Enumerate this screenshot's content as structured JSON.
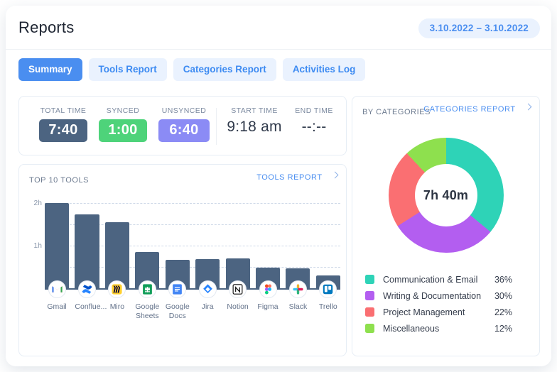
{
  "header": {
    "title": "Reports",
    "date_range": "3.10.2022 – 3.10.2022"
  },
  "tabs": [
    {
      "label": "Summary",
      "active": true
    },
    {
      "label": "Tools Report",
      "active": false
    },
    {
      "label": "Categories Report",
      "active": false
    },
    {
      "label": "Activities Log",
      "active": false
    }
  ],
  "stats": [
    {
      "label": "TOTAL TIME",
      "value": "7:40",
      "style": "pill",
      "color": "#4c6481"
    },
    {
      "label": "SYNCED",
      "value": "1:00",
      "style": "pill",
      "color": "#4ed37a"
    },
    {
      "label": "UNSYNCED",
      "value": "6:40",
      "style": "pill",
      "color": "#8b8bf5"
    },
    {
      "label": "START  TIME",
      "value": "9:18 am",
      "style": "plain",
      "color": "#303a4b"
    },
    {
      "label": "END TIME",
      "value": "--:--",
      "style": "plain",
      "color": "#303a4b"
    }
  ],
  "tools_panel": {
    "title": "TOP 10 TOOLS",
    "link": "TOOLS REPORT"
  },
  "categories_panel": {
    "title": "BY CATEGORIES",
    "link": "CATEGORIES REPORT",
    "center_label": "7h 40m"
  },
  "chart_data": [
    {
      "type": "bar",
      "title": "TOP 10 TOOLS",
      "xlabel": "",
      "ylabel": "",
      "ylim": [
        0,
        2.17
      ],
      "yticks": [
        1,
        2
      ],
      "ytick_labels": [
        "1h",
        "2h"
      ],
      "grid": true,
      "bar_color": "#4c6481",
      "categories": [
        "Gmail",
        "Conflue...",
        "Miro",
        "Google Sheets",
        "Google Docs",
        "Jira",
        "Notion",
        "Figma",
        "Slack",
        "Trello"
      ],
      "values": [
        2.0,
        1.74,
        1.55,
        0.85,
        0.67,
        0.68,
        0.7,
        0.48,
        0.47,
        0.3
      ],
      "icons": [
        "gmail-icon",
        "confluence-icon",
        "miro-icon",
        "google-sheets-icon",
        "google-docs-icon",
        "jira-icon",
        "notion-icon",
        "figma-icon",
        "slack-icon",
        "trello-icon"
      ]
    },
    {
      "type": "pie",
      "title": "BY CATEGORIES",
      "center_label": "7h 40m",
      "legend_position": "bottom",
      "labels": [
        "Communication & Email",
        "Writing & Documentation",
        "Project Management",
        "Miscellaneous"
      ],
      "values": [
        36,
        30,
        22,
        12
      ],
      "value_labels": [
        "36%",
        "30%",
        "22%",
        "12%"
      ],
      "colors": [
        "#2ed3b7",
        "#b35ef0",
        "#fa6f72",
        "#8ee04e"
      ]
    }
  ]
}
